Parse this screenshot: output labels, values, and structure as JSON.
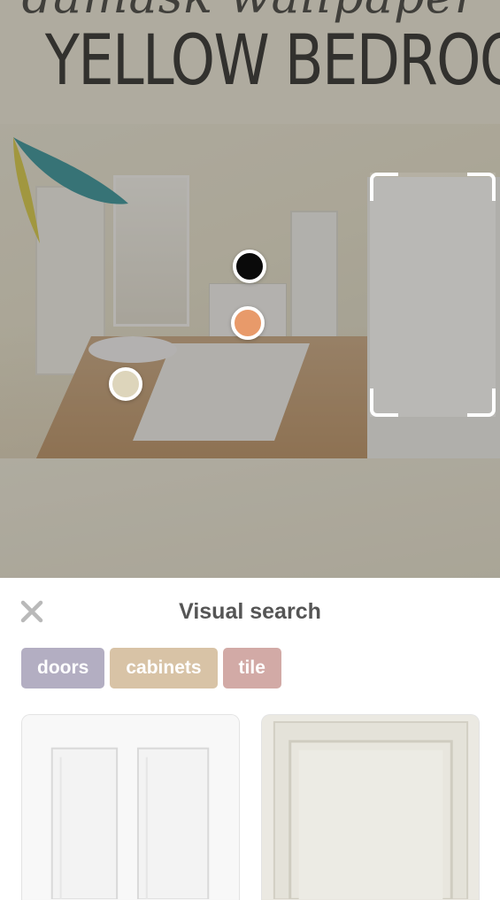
{
  "pin": {
    "script_heading": "damask wallpaper",
    "title": "YELLOW BEDROOM"
  },
  "hotspots": [
    {
      "name": "hotspot-black",
      "color": "#0a0a0a"
    },
    {
      "name": "hotspot-orange",
      "color": "#e89a6a"
    },
    {
      "name": "hotspot-beige",
      "color": "#ddd5bb"
    }
  ],
  "sheet": {
    "close_icon": "close-icon",
    "title": "Visual search",
    "chips": [
      {
        "label": "doors",
        "color": "#b3aec2"
      },
      {
        "label": "cabinets",
        "color": "#d8c3a6"
      },
      {
        "label": "tile",
        "color": "#d2aaa6"
      }
    ],
    "results": [
      {
        "name": "result-card-white-door",
        "color": "#f7f7f7"
      },
      {
        "name": "result-card-cream-door",
        "color": "#e9e7df"
      }
    ]
  }
}
